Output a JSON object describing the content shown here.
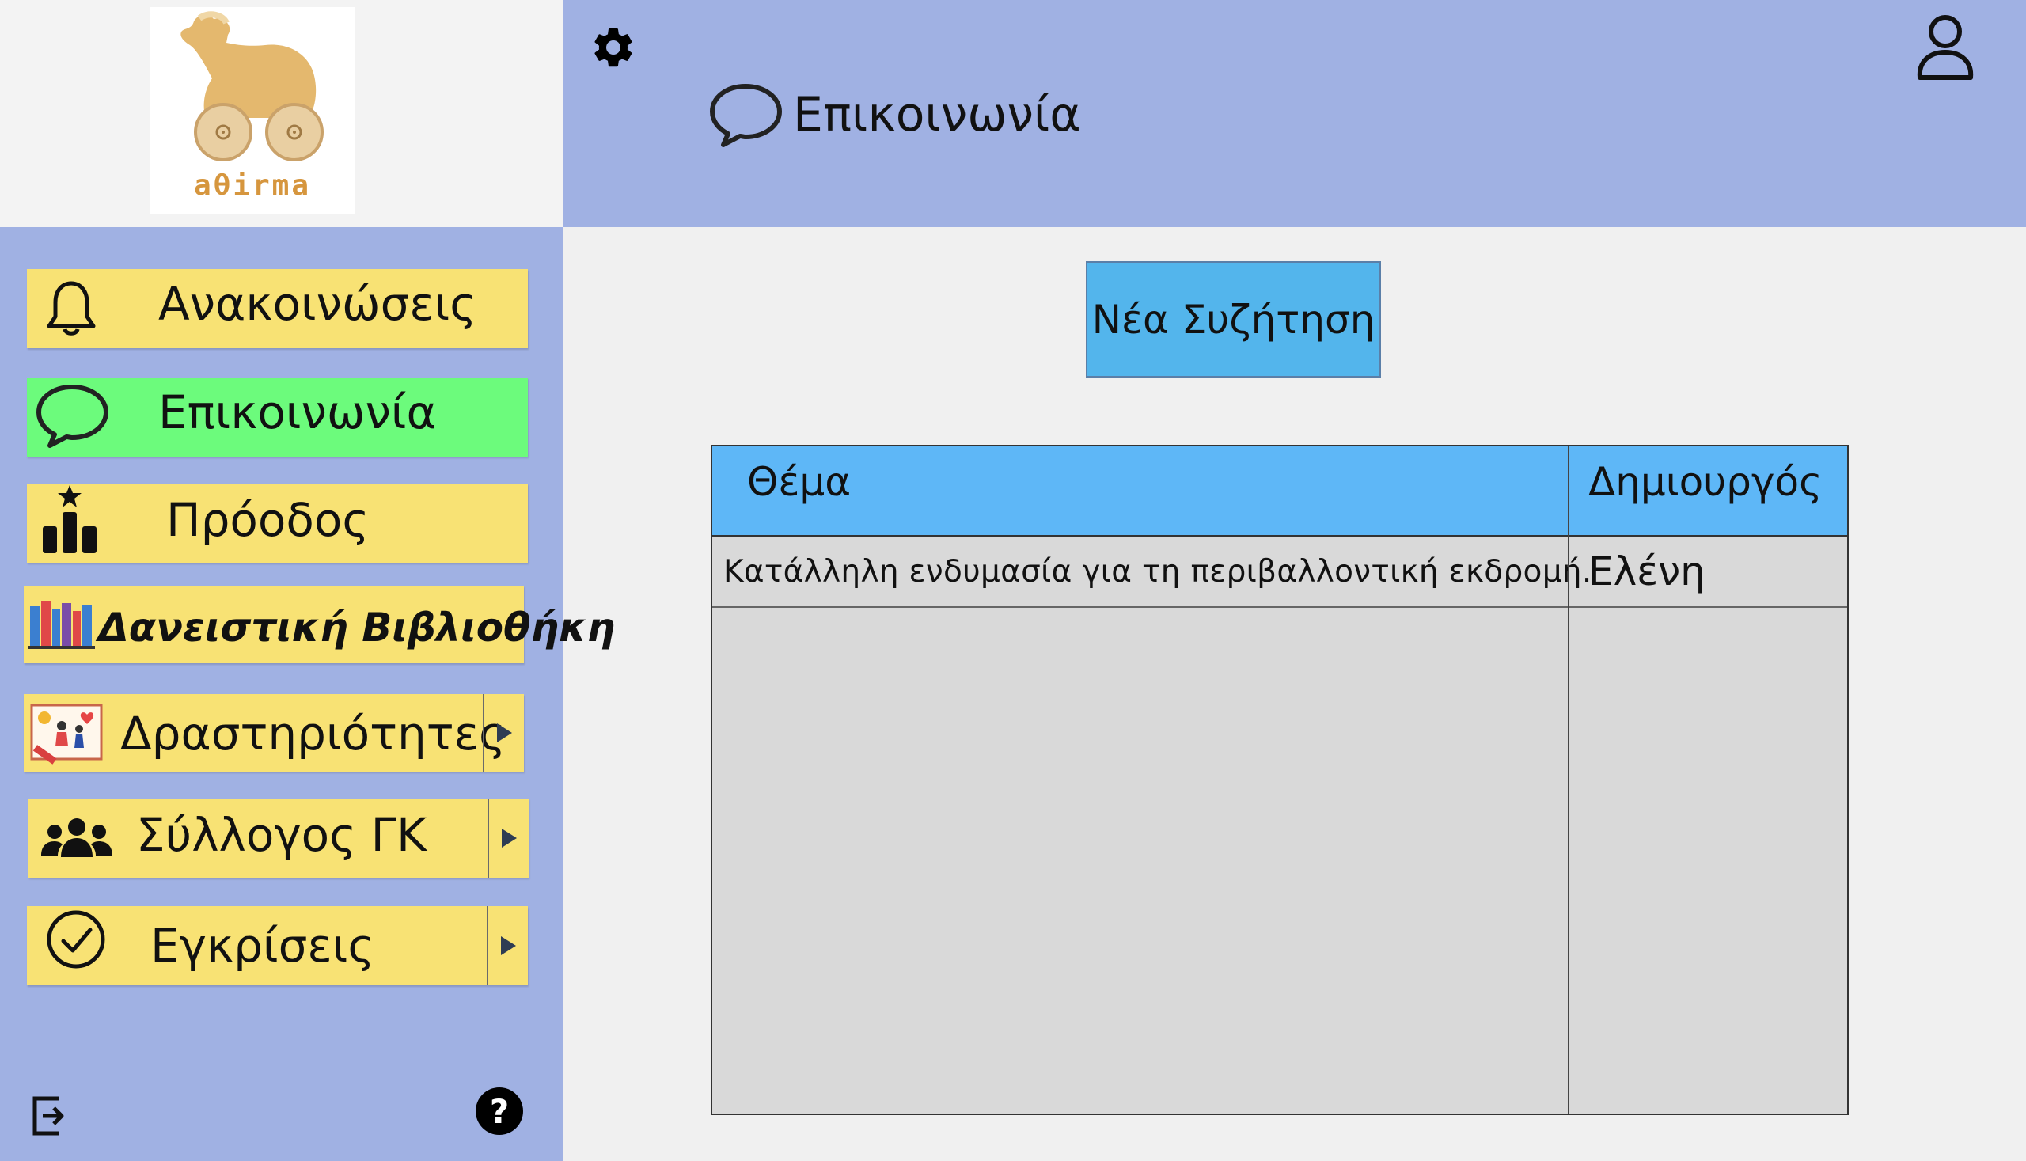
{
  "logo": {
    "text": "aθirma"
  },
  "header": {
    "title": "Επικοινωνία"
  },
  "sidebar": {
    "items": [
      {
        "label": "Ανακοινώσεις",
        "icon": "bell-icon"
      },
      {
        "label": "Επικοινωνία",
        "icon": "speech-bubble-icon",
        "active": true
      },
      {
        "label": "Πρόοδος",
        "icon": "podium-star-icon"
      },
      {
        "label": "Δανειστική Βιβλιοθήκη",
        "icon": "books-icon"
      },
      {
        "label": "Δραστηριότητες",
        "icon": "kids-drawing-icon",
        "submenu": true
      },
      {
        "label": "Σύλλογος ΓΚ",
        "icon": "people-group-icon",
        "submenu": true
      },
      {
        "label": "Εγκρίσεις",
        "icon": "check-circle-icon",
        "submenu": true
      }
    ]
  },
  "main": {
    "new_discussion_label": "Νέα Συζήτηση",
    "table": {
      "columns": [
        "Θέμα",
        "Δημιουργός"
      ],
      "rows": [
        {
          "topic": "Κατάλληλη ενδυμασία για τη περιβαλλοντική εκδρομή.",
          "creator": "Ελένη"
        }
      ]
    }
  },
  "colors": {
    "sidebar_bg": "#a0b1e3",
    "nav_item": "#f8e274",
    "nav_active": "#6cfb7c",
    "table_header": "#5eb7f7",
    "button": "#53b5ec"
  }
}
